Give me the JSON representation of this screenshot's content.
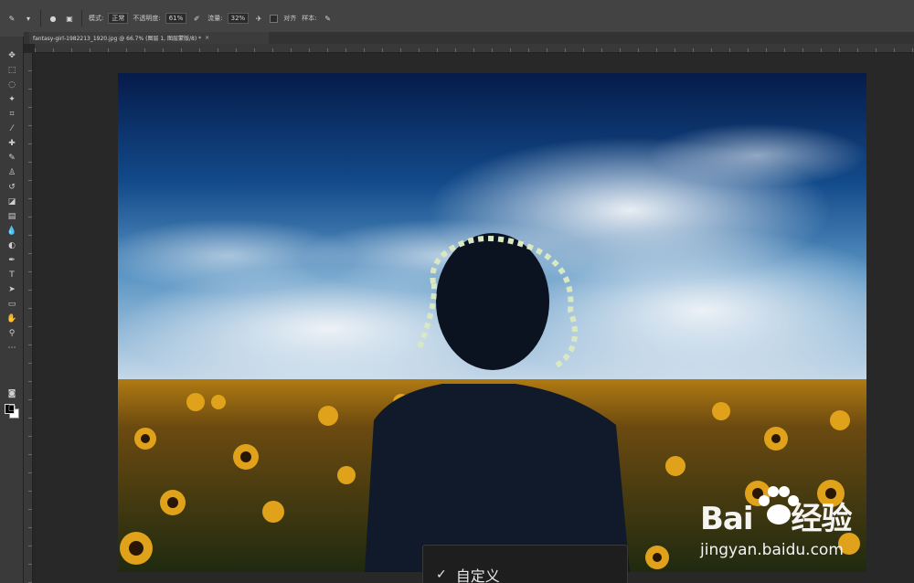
{
  "options_bar": {
    "mode_label": "模式:",
    "mode_value": "正常",
    "opacity_label": "不透明度:",
    "opacity_value": "61%",
    "flow_label": "流量:",
    "flow_value": "32%",
    "align_label": "对齐",
    "sample_label": "样本:"
  },
  "document_tab": {
    "title": "fantasy-girl-1982213_1920.jpg @ 66.7% (图层 1, 图层蒙版/8) *",
    "close": "×"
  },
  "popup_menu": {
    "selected_item": "自定义",
    "check": "✓"
  },
  "watermark": {
    "brand": "Bai",
    "brand_tail": "经验",
    "url": "jingyan.baidu.com"
  },
  "colors": {
    "ui_dark": "#262626",
    "panel": "#434343",
    "sky": "#0c2a5a",
    "sunflower": "#e0a21a"
  }
}
